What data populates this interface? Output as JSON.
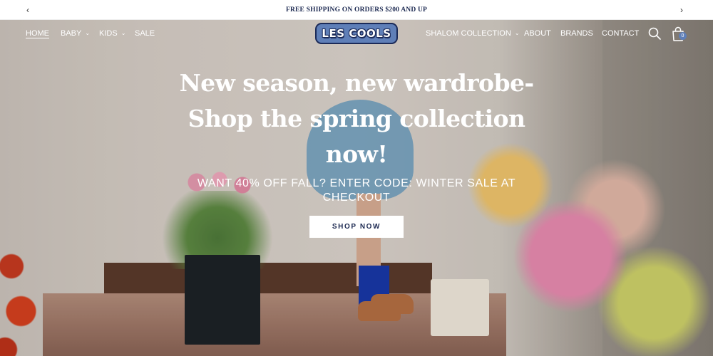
{
  "announcement": {
    "message": "FREE SHIPPING ON ORDERS $200 AND UP",
    "prev_icon": "chevron-left-icon",
    "next_icon": "chevron-right-icon",
    "prev_glyph": "‹",
    "next_glyph": "›"
  },
  "nav": {
    "left": [
      {
        "label": "HOME",
        "active": true
      },
      {
        "label": "BABY",
        "dropdown": true
      },
      {
        "label": "KIDS",
        "dropdown": true
      },
      {
        "label": "SALE"
      }
    ],
    "logo_text": "LES COOLS",
    "right": [
      {
        "label": "SHALOM COLLECTION",
        "dropdown": true
      },
      {
        "label": "ABOUT"
      },
      {
        "label": "BRANDS"
      },
      {
        "label": "CONTACT"
      }
    ],
    "dropdown_glyph": "⌄",
    "search_icon": "search-icon",
    "cart_icon": "shopping-bag-icon",
    "cart_count": "0"
  },
  "hero": {
    "headline": "New season, new wardrobe- Shop the spring collection now!",
    "subline": "WANT 40% OFF FALL? ENTER CODE: WINTER SALE AT CHECKOUT",
    "cta_label": "SHOP NOW"
  },
  "colors": {
    "accent": "#5f7fb8",
    "navy": "#1d2a52"
  }
}
